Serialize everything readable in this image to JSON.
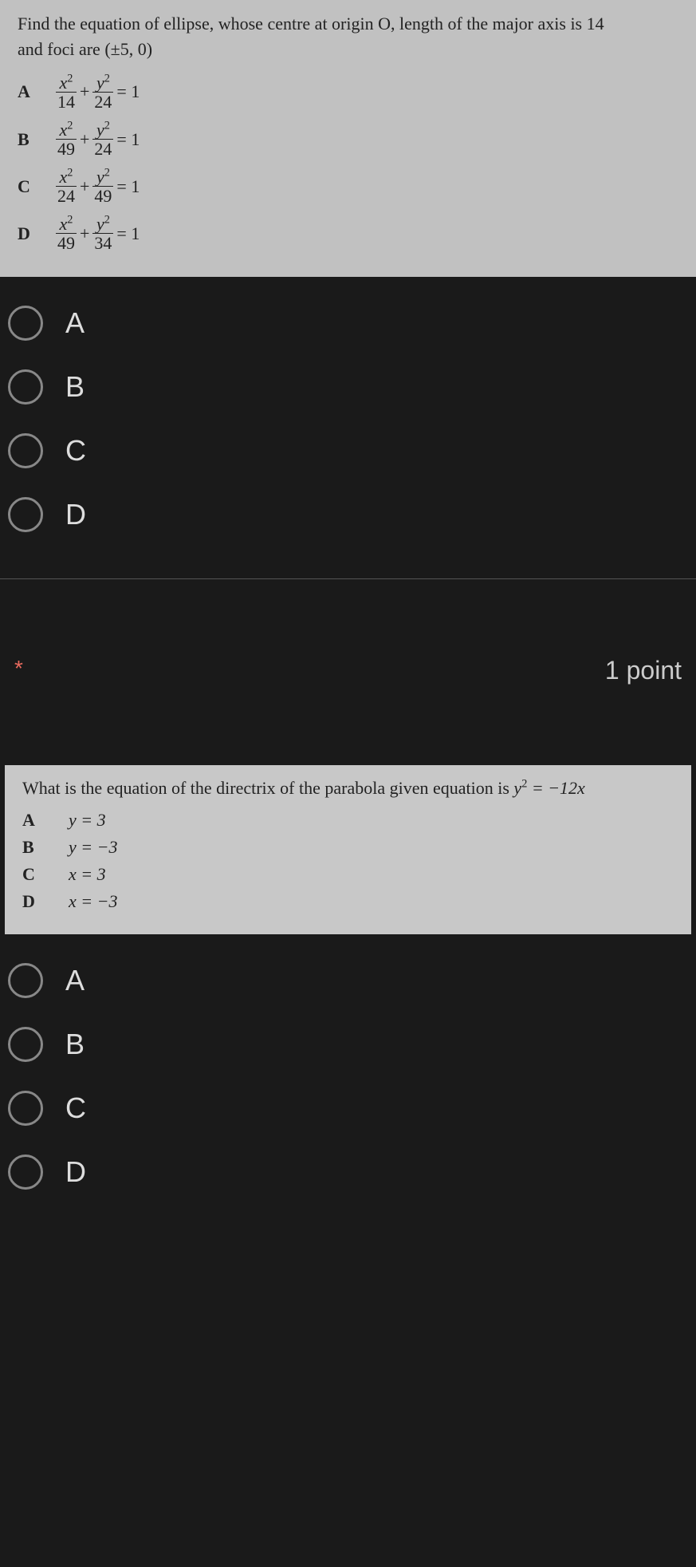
{
  "q1": {
    "prompt_line1": "Find the equation of ellipse, whose centre at origin O, length of the major axis is 14",
    "prompt_line2": "and foci are (±5, 0)",
    "options": {
      "A": {
        "letter": "A",
        "den1": "14",
        "den2": "24"
      },
      "B": {
        "letter": "B",
        "den1": "49",
        "den2": "24"
      },
      "C": {
        "letter": "C",
        "den1": "24",
        "den2": "49"
      },
      "D": {
        "letter": "D",
        "den1": "49",
        "den2": "34"
      }
    },
    "num_x": "x",
    "num_y": "y",
    "sup": "2",
    "plus": "+",
    "eq": "= 1"
  },
  "radios1": {
    "A": "A",
    "B": "B",
    "C": "C",
    "D": "D"
  },
  "required_mark": "*",
  "points_text": "1 point",
  "q2": {
    "prompt_pre": "What is the equation of the directrix of the parabola given equation is  ",
    "prompt_eq_lhs": "y",
    "prompt_eq_sup": "2",
    "prompt_eq_rhs": " = −12x",
    "options": {
      "A": {
        "letter": "A",
        "eq": "y = 3"
      },
      "B": {
        "letter": "B",
        "eq": "y = −3"
      },
      "C": {
        "letter": "C",
        "eq": "x = 3"
      },
      "D": {
        "letter": "D",
        "eq": "x = −3"
      }
    }
  },
  "radios2": {
    "A": "A",
    "B": "B",
    "C": "C",
    "D": "D"
  }
}
